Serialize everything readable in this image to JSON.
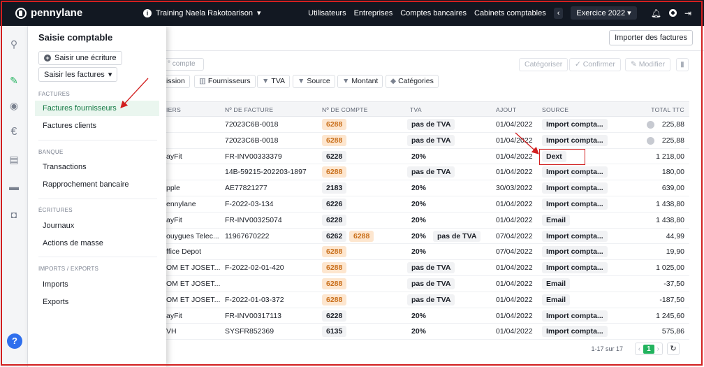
{
  "topbar": {
    "brand": "pennylane",
    "company": "Training Naela Rakotoarison",
    "nav": [
      "Utilisateurs",
      "Entreprises",
      "Comptes bancaires",
      "Cabinets comptables"
    ],
    "exercice": "Exercice 2022",
    "icons": [
      "bell-icon",
      "gear-icon",
      "logout-icon"
    ]
  },
  "rail": {
    "icons": [
      "search-icon",
      "accounting-icon",
      "clock-icon",
      "euro-icon",
      "book-icon",
      "folder-icon",
      "contact-icon"
    ],
    "help": "?"
  },
  "drawer": {
    "title": "Saisie comptable",
    "new_entry": "Saisir une écriture",
    "invoices_btn": "Saisir les factures",
    "sections": {
      "factures": "FACTURES",
      "banque": "BANQUE",
      "ecritures": "ÉCRITURES",
      "imports": "IMPORTS / EXPORTS"
    },
    "items": {
      "factures_fournisseurs": "Factures fournisseurs",
      "factures_clients": "Factures clients",
      "transactions": "Transactions",
      "rapprochement": "Rapprochement bancaire",
      "journaux": "Journaux",
      "actions_masse": "Actions de masse",
      "imports": "Imports",
      "exports": "Exports"
    }
  },
  "main": {
    "import_button": "Importer des factures",
    "search_placeholder": "° compte",
    "toolbar": {
      "categoriser": "Catégoriser",
      "confirmer": "Confirmer",
      "modifier": "Modifier"
    },
    "filters": {
      "emission": "ission",
      "fournisseurs": "Fournisseurs",
      "tva": "TVA",
      "source": "Source",
      "montant": "Montant",
      "categories": "Catégories"
    },
    "columns": {
      "fournisseur": "IERS",
      "facture": "Nº DE FACTURE",
      "compte": "Nº DE COMPTE",
      "tva": "TVA",
      "ajout": "AJOUT",
      "source": "SOURCE",
      "total": "TOTAL TTC"
    },
    "rows": [
      {
        "supplier": "",
        "invoice": "72023C6B-0018",
        "account": "6288",
        "account_highlight": true,
        "account2": "",
        "tva": "pas de TVA",
        "tva_tag": true,
        "tva2": "",
        "date": "01/04/2022",
        "source": "Import compta...",
        "total": "225,88",
        "warning": true
      },
      {
        "supplier": "",
        "invoice": "72023C6B-0018",
        "account": "6288",
        "account_highlight": true,
        "account2": "",
        "tva": "pas de TVA",
        "tva_tag": true,
        "tva2": "",
        "date": "01/04/2022",
        "source": "Import compta...",
        "total": "225,88",
        "warning": true
      },
      {
        "supplier": "ayFit",
        "invoice": "FR-INV00333379",
        "account": "6228",
        "account_highlight": false,
        "account2": "",
        "tva": "20%",
        "tva_tag": false,
        "tva2": "",
        "date": "01/04/2022",
        "source": "Dext",
        "total": "1 218,00",
        "warning": false
      },
      {
        "supplier": "",
        "invoice": "14B-59215-202203-1897",
        "account": "6288",
        "account_highlight": true,
        "account2": "",
        "tva": "pas de TVA",
        "tva_tag": true,
        "tva2": "",
        "date": "01/04/2022",
        "source": "Import compta...",
        "total": "180,00",
        "warning": false
      },
      {
        "supplier": "pple",
        "invoice": "AE77821277",
        "account": "2183",
        "account_highlight": false,
        "account2": "",
        "tva": "20%",
        "tva_tag": false,
        "tva2": "",
        "date": "30/03/2022",
        "source": "Import compta...",
        "total": "639,00",
        "warning": false
      },
      {
        "supplier": "ennylane",
        "invoice": "F-2022-03-134",
        "account": "6226",
        "account_highlight": false,
        "account2": "",
        "tva": "20%",
        "tva_tag": false,
        "tva2": "",
        "date": "01/04/2022",
        "source": "Import compta...",
        "total": "1 438,80",
        "warning": false
      },
      {
        "supplier": "ayFit",
        "invoice": "FR-INV00325074",
        "account": "6228",
        "account_highlight": false,
        "account2": "",
        "tva": "20%",
        "tva_tag": false,
        "tva2": "",
        "date": "01/04/2022",
        "source": "Email",
        "total": "1 438,80",
        "warning": false
      },
      {
        "supplier": "ouygues Telec...",
        "invoice": "11967670222",
        "account": "6262",
        "account_highlight": false,
        "account2": "6288",
        "tva": "20%",
        "tva_tag": false,
        "tva2": "pas de TVA",
        "date": "07/04/2022",
        "source": "Import compta...",
        "total": "44,99",
        "warning": false
      },
      {
        "supplier": "ffice Depot",
        "invoice": "",
        "account": "6288",
        "account_highlight": true,
        "account2": "",
        "tva": "20%",
        "tva_tag": false,
        "tva2": "",
        "date": "07/04/2022",
        "source": "Import compta...",
        "total": "19,90",
        "warning": false
      },
      {
        "supplier": "OM ET JOSET...",
        "invoice": "F-2022-02-01-420",
        "account": "6288",
        "account_highlight": true,
        "account2": "",
        "tva": "pas de TVA",
        "tva_tag": true,
        "tva2": "",
        "date": "01/04/2022",
        "source": "Import compta...",
        "total": "1 025,00",
        "warning": false
      },
      {
        "supplier": "OM ET JOSET...",
        "invoice": "",
        "account": "6288",
        "account_highlight": true,
        "account2": "",
        "tva": "pas de TVA",
        "tva_tag": true,
        "tva2": "",
        "date": "01/04/2022",
        "source": "Email",
        "total": "-37,50",
        "warning": false
      },
      {
        "supplier": "OM ET JOSET...",
        "invoice": "F-2022-01-03-372",
        "account": "6288",
        "account_highlight": true,
        "account2": "",
        "tva": "pas de TVA",
        "tva_tag": true,
        "tva2": "",
        "date": "01/04/2022",
        "source": "Email",
        "total": "-187,50",
        "warning": false
      },
      {
        "supplier": "ayFit",
        "invoice": "FR-INV00317113",
        "account": "6228",
        "account_highlight": false,
        "account2": "",
        "tva": "20%",
        "tva_tag": false,
        "tva2": "",
        "date": "01/04/2022",
        "source": "Import compta...",
        "total": "1 245,60",
        "warning": false
      },
      {
        "supplier": "VH",
        "invoice": "SYSFR852369",
        "account": "6135",
        "account_highlight": false,
        "account2": "",
        "tva": "20%",
        "tva_tag": false,
        "tva2": "",
        "date": "01/04/2022",
        "source": "Import compta...",
        "total": "575,86",
        "warning": false
      }
    ],
    "pagination": {
      "range": "1-17 sur 17",
      "page": "1"
    }
  },
  "colors": {
    "topbar": "#121822",
    "accent_green": "#22b35e",
    "annotation_red": "#d21f1f",
    "account_orange": "#fde6cf"
  }
}
